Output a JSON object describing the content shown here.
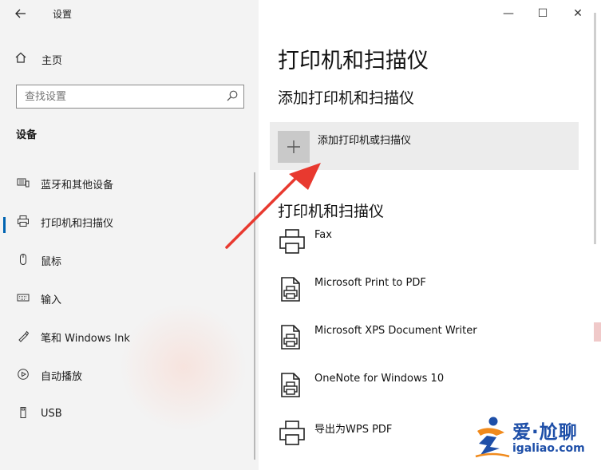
{
  "window": {
    "title": "设置",
    "controls": {
      "minimize": "—",
      "maximize": "☐",
      "close": "✕"
    }
  },
  "sidebar": {
    "home_label": "主页",
    "search": {
      "placeholder": "查找设置"
    },
    "section_title": "设备",
    "items": [
      {
        "label": "蓝牙和其他设备",
        "icon": "bluetooth-devices-icon",
        "selected": false
      },
      {
        "label": "打印机和扫描仪",
        "icon": "printer-icon",
        "selected": true
      },
      {
        "label": "鼠标",
        "icon": "mouse-icon",
        "selected": false
      },
      {
        "label": "输入",
        "icon": "keyboard-icon",
        "selected": false
      },
      {
        "label": "笔和 Windows Ink",
        "icon": "pen-icon",
        "selected": false
      },
      {
        "label": "自动播放",
        "icon": "autoplay-icon",
        "selected": false
      },
      {
        "label": "USB",
        "icon": "usb-icon",
        "selected": false
      }
    ]
  },
  "main": {
    "page_title": "打印机和扫描仪",
    "add_section_title": "添加打印机和扫描仪",
    "add_button_label": "添加打印机或扫描仪",
    "list_title": "打印机和扫描仪",
    "printers": [
      {
        "name": "Fax",
        "icon": "printer-icon"
      },
      {
        "name": "Microsoft Print to PDF",
        "icon": "document-printer-icon"
      },
      {
        "name": "Microsoft XPS Document Writer",
        "icon": "document-printer-icon"
      },
      {
        "name": "OneNote for Windows 10",
        "icon": "document-printer-icon"
      },
      {
        "name": "导出为WPS PDF",
        "icon": "printer-icon"
      }
    ]
  },
  "watermark": {
    "brand_cn": "爱·尬聊",
    "url": "igaliao.com"
  },
  "colors": {
    "accent": "#0063b1",
    "arrow": "#e8392f",
    "watermark_blue": "#1e4fa8",
    "watermark_orange": "#f08a1c"
  }
}
